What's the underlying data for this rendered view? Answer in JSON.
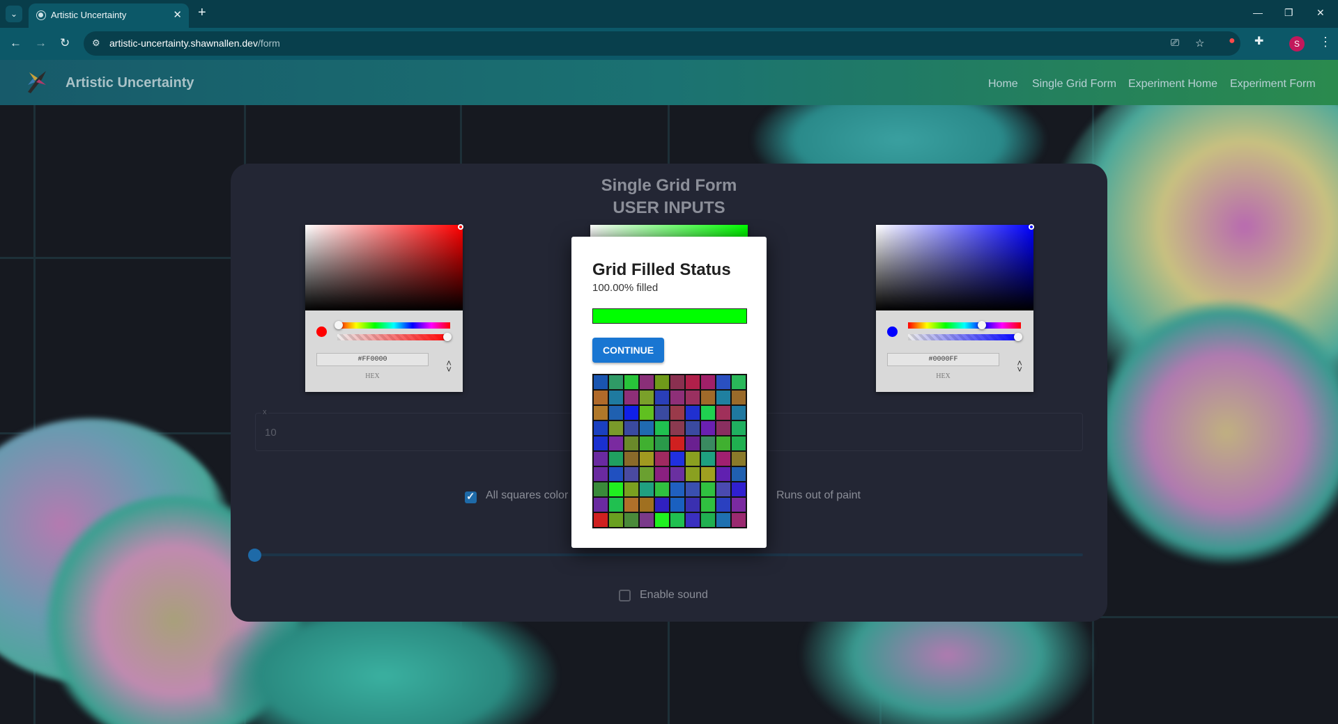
{
  "browser": {
    "tab_title": "Artistic Uncertainty",
    "url_host": "artistic-uncertainty.shawnallen.dev",
    "url_path": "/form",
    "profile_initial": "S"
  },
  "header": {
    "brand": "Artistic Uncertainty",
    "nav": [
      "Home",
      "Single Grid Form",
      "Experiment Home",
      "Experiment Form"
    ]
  },
  "form": {
    "title_line1": "Single Grid Form",
    "title_line2": "USER INPUTS",
    "pickers": [
      {
        "hex": "#FF0000",
        "format_label": "HEX",
        "color": "#ff0000"
      },
      {
        "hex": "",
        "format_label": "",
        "color": "#00ff00"
      },
      {
        "hex": "#0000FF",
        "format_label": "HEX",
        "color": "#0000ff"
      }
    ],
    "field_label": "x",
    "field_value": "10",
    "stop_condition_left": "All squares color",
    "stop_condition_right": "Runs out of paint",
    "enable_sound_label": "Enable sound"
  },
  "modal": {
    "title": "Grid Filled Status",
    "status": "100.00% filled",
    "progress_fraction": 1.0,
    "progress_color": "#00ff00",
    "continue_label": "CONTINUE",
    "grid_colors": [
      [
        "#1a55b0",
        "#2f9a66",
        "#28c43a",
        "#8a2f78",
        "#6f9a1a",
        "#8a3050",
        "#b0204a",
        "#a02068",
        "#2a50c0",
        "#2ab85a"
      ],
      [
        "#b06a2a",
        "#1f7aa0",
        "#8e2f78",
        "#7aa02a",
        "#2a3fb8",
        "#8e2f78",
        "#9a3060",
        "#a06a2a",
        "#1f80a0",
        "#9a6a2a"
      ],
      [
        "#b0782a",
        "#1f60b0",
        "#1020e8",
        "#60c020",
        "#3a4aa0",
        "#9a3a4a",
        "#2030d0",
        "#20d050",
        "#a0305a",
        "#1f78a0"
      ],
      [
        "#1a40c0",
        "#7a9a2a",
        "#3a4aa0",
        "#206ab0",
        "#20c050",
        "#8a3a50",
        "#3a4aa0",
        "#6a20b0",
        "#8a2f60",
        "#20b060"
      ],
      [
        "#1a30d0",
        "#7a2aa0",
        "#6a8a2a",
        "#40b030",
        "#2a9a4a",
        "#d02020",
        "#6a2090",
        "#3a8a60",
        "#40b030",
        "#20b050"
      ],
      [
        "#6a2aa0",
        "#20a060",
        "#8a6a2a",
        "#a09a20",
        "#a02a60",
        "#2030e0",
        "#8aa020",
        "#1fa080",
        "#a02070",
        "#8a7a2a"
      ],
      [
        "#6a2aa0",
        "#2050c0",
        "#4a4aa0",
        "#6aa030",
        "#8a2080",
        "#6a30a0",
        "#8aa020",
        "#a0a020",
        "#6020b0",
        "#2060b0"
      ],
      [
        "#3a8a3a",
        "#20f020",
        "#7aa020",
        "#20a080",
        "#30c040",
        "#2060c0",
        "#3a50b0",
        "#30c040",
        "#4a4ab0",
        "#3020d0"
      ],
      [
        "#6a2aa0",
        "#20c050",
        "#b0702a",
        "#a07020",
        "#3020c0",
        "#1a60c0",
        "#3a30b0",
        "#30c040",
        "#2a40c0",
        "#7a2aa0"
      ],
      [
        "#d02020",
        "#6aa020",
        "#4a8a3a",
        "#7a3a8a",
        "#20f020",
        "#20c050",
        "#3a30c0",
        "#20b050",
        "#1f70b0",
        "#9a2a70"
      ]
    ]
  }
}
